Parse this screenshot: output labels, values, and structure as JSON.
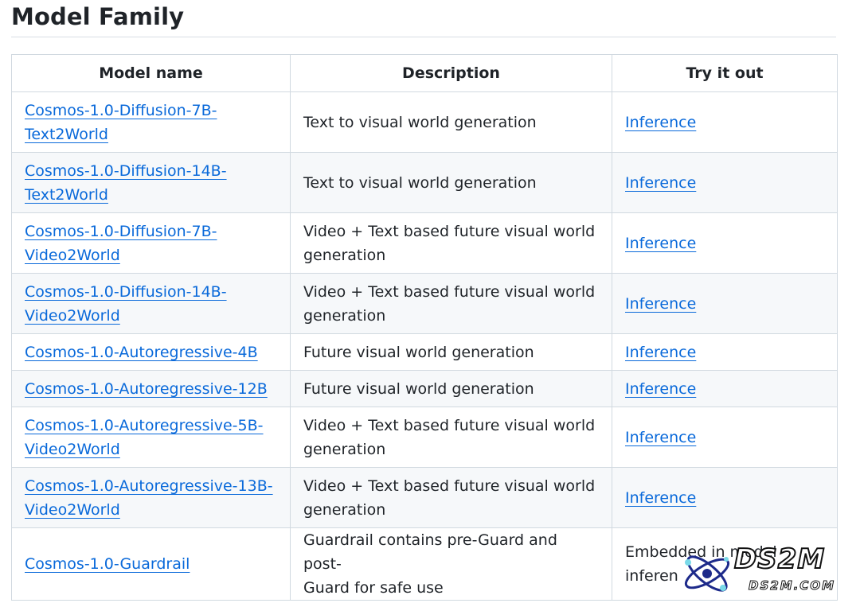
{
  "heading": "Model Family",
  "table": {
    "headers": [
      "Model name",
      "Description",
      "Try it out"
    ],
    "rows": [
      {
        "name_line1": "Cosmos-1.0-Diffusion-7B-",
        "name_line2": "Text2World",
        "desc_line1": "Text to visual world generation",
        "desc_line2": "",
        "try": "Inference",
        "try_line2": ""
      },
      {
        "name_line1": "Cosmos-1.0-Diffusion-14B-",
        "name_line2": "Text2World",
        "desc_line1": "Text to visual world generation",
        "desc_line2": "",
        "try": "Inference",
        "try_line2": ""
      },
      {
        "name_line1": "Cosmos-1.0-Diffusion-7B-",
        "name_line2": "Video2World",
        "desc_line1": "Video + Text based future visual world",
        "desc_line2": "generation",
        "try": "Inference",
        "try_line2": ""
      },
      {
        "name_line1": "Cosmos-1.0-Diffusion-14B-",
        "name_line2": "Video2World",
        "desc_line1": "Video + Text based future visual world",
        "desc_line2": "generation",
        "try": "Inference",
        "try_line2": ""
      },
      {
        "name_line1": "Cosmos-1.0-Autoregressive-4B",
        "name_line2": "",
        "desc_line1": "Future visual world generation",
        "desc_line2": "",
        "try": "Inference",
        "try_line2": ""
      },
      {
        "name_line1": "Cosmos-1.0-Autoregressive-12B",
        "name_line2": "",
        "desc_line1": "Future visual world generation",
        "desc_line2": "",
        "try": "Inference",
        "try_line2": ""
      },
      {
        "name_line1": "Cosmos-1.0-Autoregressive-5B-",
        "name_line2": "Video2World",
        "desc_line1": "Video + Text based future visual world",
        "desc_line2": "generation",
        "try": "Inference",
        "try_line2": ""
      },
      {
        "name_line1": "Cosmos-1.0-Autoregressive-13B-",
        "name_line2": "Video2World",
        "desc_line1": "Video + Text based future visual world",
        "desc_line2": "generation",
        "try": "Inference",
        "try_line2": ""
      },
      {
        "name_line1": "Cosmos-1.0-Guardrail",
        "name_line2": "",
        "desc_line1": "Guardrail contains pre-Guard and post-",
        "desc_line2": "Guard for safe use",
        "try": "Embedded in model",
        "try_line2": "inferen"
      }
    ]
  },
  "watermark": {
    "main": "DS2M",
    "sub": "DS2M.COM",
    "icon": "atom-logo-icon"
  }
}
